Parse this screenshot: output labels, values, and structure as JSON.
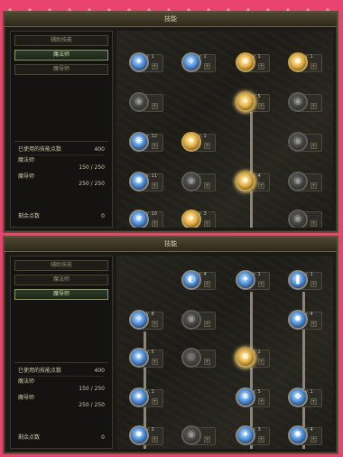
{
  "panel_top": {
    "title": "技能",
    "tabs": [
      "辅助技能",
      "魔法师",
      "魔导师"
    ],
    "active_tab": 1,
    "stats": {
      "used_label": "已使用的技能点数",
      "used_value": "400",
      "rows": [
        {
          "label": "魔法师",
          "value": "150 / 250"
        },
        {
          "label": "魔导师",
          "value": "250 / 250"
        }
      ],
      "remain_label": "剩余点数",
      "remain_value": "0"
    },
    "skills": [
      {
        "lv": "Lv. 1",
        "style": "blue",
        "glyph": "✦"
      },
      {
        "lv": "Lv. 1",
        "style": "blue",
        "glyph": "✧"
      },
      {
        "lv": "Lv. 1",
        "style": "gold",
        "glyph": "✺"
      },
      {
        "lv": "Lv. 1",
        "style": "gold",
        "glyph": "✹"
      },
      {
        "lv": "",
        "style": "gray",
        "glyph": "◉"
      },
      {
        "lv": "Lv. 5",
        "style": "gold",
        "glyph": "✶"
      },
      {
        "lv": "",
        "style": "gray",
        "glyph": "◉"
      },
      {
        "lv": "Lv. 12",
        "style": "blue",
        "glyph": "❋"
      },
      {
        "lv": "Lv. 1",
        "style": "gold",
        "glyph": "✷"
      },
      {
        "lv": "",
        "style": "gray",
        "glyph": "◉"
      },
      {
        "lv": "Lv. 11",
        "style": "blue",
        "glyph": "✺"
      },
      {
        "lv": "",
        "style": "gray",
        "glyph": "◉"
      },
      {
        "lv": "Lv. 4",
        "style": "gold",
        "glyph": "✸"
      },
      {
        "lv": "",
        "style": "gray",
        "glyph": "◉"
      },
      {
        "lv": "Lv. 10",
        "style": "blue",
        "glyph": "✵"
      },
      {
        "lv": "Lv. 3",
        "style": "gold",
        "glyph": "✦"
      },
      {
        "lv": "",
        "style": "gray",
        "glyph": "◉"
      }
    ]
  },
  "panel_bottom": {
    "title": "技能",
    "tabs": [
      "辅助技能",
      "魔法师",
      "魔导师"
    ],
    "active_tab": 2,
    "stats": {
      "used_label": "已使用的技能点数",
      "used_value": "400",
      "rows": [
        {
          "label": "魔法师",
          "value": "150 / 250"
        },
        {
          "label": "魔导师",
          "value": "250 / 250"
        }
      ],
      "remain_label": "剩余点数",
      "remain_value": "0"
    },
    "skills": [
      {
        "lv": "Lv. 4",
        "style": "blue",
        "glyph": "◐"
      },
      {
        "lv": "Lv. 1",
        "style": "blue",
        "glyph": "✦"
      },
      {
        "lv": "Lv. 1",
        "style": "blue",
        "glyph": "❚"
      },
      {
        "lv": "Lv. 8",
        "style": "blue",
        "glyph": "✧"
      },
      {
        "lv": "",
        "style": "gray",
        "glyph": "◉"
      },
      {
        "lv": "Lv. 4",
        "style": "blue",
        "glyph": "✹"
      },
      {
        "lv": "Lv. 5",
        "style": "blue",
        "glyph": "✶"
      },
      {
        "lv": "",
        "style": "gray",
        "glyph": "◎"
      },
      {
        "lv": "Lv. 1",
        "style": "gold",
        "glyph": "✺"
      },
      {
        "lv": "Lv. 1",
        "style": "blue",
        "glyph": "✷"
      },
      {
        "lv": "Lv. 5",
        "style": "blue",
        "glyph": "✵"
      },
      {
        "lv": "Lv. 1",
        "style": "blue",
        "glyph": "❖"
      },
      {
        "lv": "Lv. 2",
        "style": "blue",
        "glyph": "✸"
      },
      {
        "lv": "Lv. 3",
        "style": "blue",
        "glyph": "✦"
      },
      {
        "lv": "",
        "style": "gray",
        "glyph": "◉"
      },
      {
        "lv": "Lv. 4",
        "style": "blue",
        "glyph": "✹"
      },
      {
        "lv": "Lv. 3",
        "style": "gold",
        "glyph": "✺"
      }
    ]
  }
}
